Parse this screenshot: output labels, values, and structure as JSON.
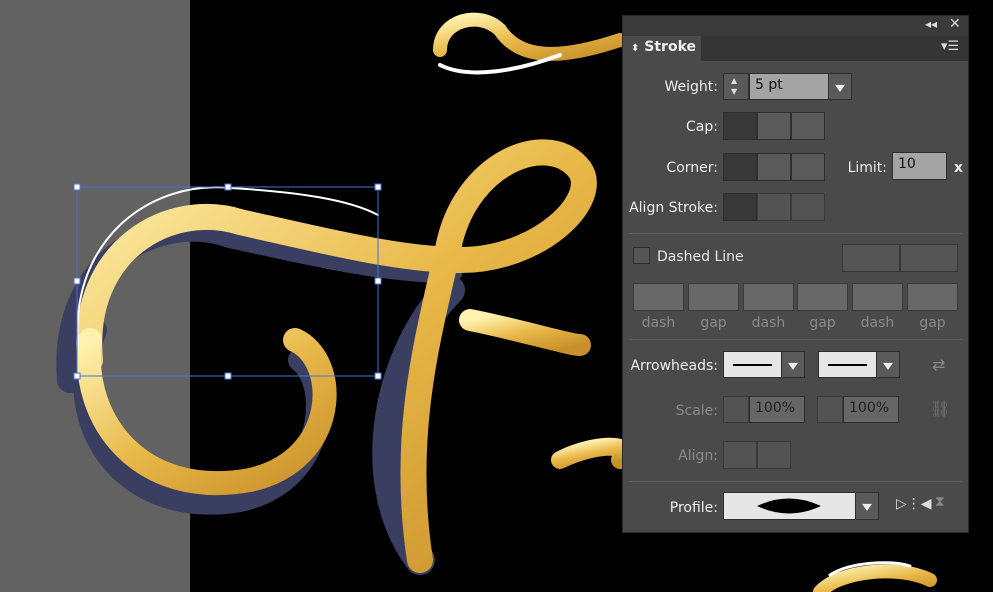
{
  "panel": {
    "tab_title": "Stroke",
    "weight": {
      "label": "Weight:",
      "value": "5 pt"
    },
    "cap": {
      "label": "Cap:",
      "options": [
        "butt-cap-icon",
        "round-cap-icon",
        "projecting-cap-icon"
      ],
      "selected": 0
    },
    "corner": {
      "label": "Corner:",
      "selected": 0
    },
    "limit": {
      "label": "Limit:",
      "value": "10",
      "unit": "x"
    },
    "align_stroke": {
      "label": "Align Stroke:",
      "selected": 0
    },
    "dashed": {
      "label": "Dashed Line",
      "checked": false,
      "fields": [
        "dash",
        "gap",
        "dash",
        "gap",
        "dash",
        "gap"
      ]
    },
    "arrowheads": {
      "label": "Arrowheads:"
    },
    "scale": {
      "label": "Scale:",
      "start": "100%",
      "end": "100%"
    },
    "align": {
      "label": "Align:"
    },
    "profile": {
      "label": "Profile:"
    }
  },
  "colors": {
    "panel_bg": "#4a4a4a",
    "selection": "#4a6fd8",
    "gold": "#f0c850",
    "shadow": "#3a3f62",
    "pasteboard": "#626262"
  }
}
